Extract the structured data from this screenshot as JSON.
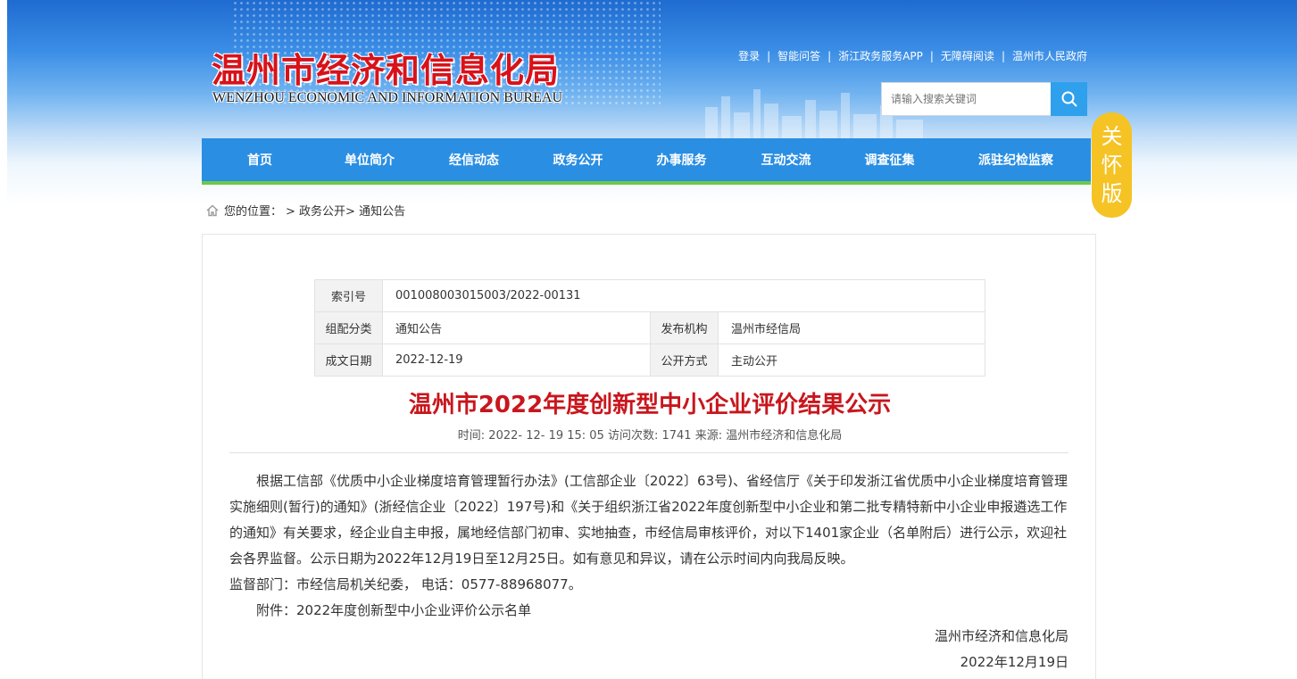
{
  "header": {
    "title_cn": "温州市经济和信息化局",
    "title_en": "WENZHOU ECONOMIC AND INFORMATION BUREAU",
    "links": [
      "登录",
      "智能问答",
      "浙江政务服务APP",
      "无障碍阅读",
      "温州市人民政府"
    ],
    "search_placeholder": "请输入搜索关键词"
  },
  "nav": {
    "items": [
      "首页",
      "单位简介",
      "经信动态",
      "政务公开",
      "办事服务",
      "互动交流",
      "调查征集",
      "派驻纪检监察"
    ]
  },
  "care_badge": [
    "关",
    "怀",
    "版"
  ],
  "breadcrumb": {
    "prefix": "您的位置：",
    "items": [
      "> 政务公开",
      "> 通知公告"
    ]
  },
  "meta": {
    "index_label": "索引号",
    "index_value": "001008003015003/2022-00131",
    "category_label": "组配分类",
    "category_value": "通知公告",
    "publisher_label": "发布机构",
    "publisher_value": "温州市经信局",
    "date_label": "成文日期",
    "date_value": "2022-12-19",
    "open_label": "公开方式",
    "open_value": "主动公开"
  },
  "article": {
    "title": "温州市2022年度创新型中小企业评价结果公示",
    "info": "时间:   2022- 12- 19 15: 05 访问次数:    1741     来源: 温州市经济和信息化局",
    "paragraph1": "根据工信部《优质中小企业梯度培育管理暂行办法》(工信部企业〔2022〕63号)、省经信厅《关于印发浙江省优质中小企业梯度培育管理实施细则(暂行)的通知》(浙经信企业〔2022〕197号)和《关于组织浙江省2022年度创新型中小企业和第二批专精特新中小企业申报遴选工作的通知》有关要求，经企业自主申报，属地经信部门初审、实地抽查，市经信局审核评价，对以下1401家企业（名单附后）进行公示，欢迎社会各界监督。公示日期为2022年12月19日至12月25日。如有意见和异议，请在公示时间内向我局反映。",
    "supervision": "监督部门：市经信局机关纪委， 电话：0577-88968077。",
    "attachment": "附件：2022年度创新型中小企业评价公示名单",
    "sign_org": "温州市经济和信息化局",
    "sign_date": "2022年12月19日"
  },
  "colors": {
    "nav_bg": "#2a8ee3",
    "nav_underline": "#68c94a",
    "title_red": "#c8161d",
    "badge_yellow": "#f5c324"
  }
}
